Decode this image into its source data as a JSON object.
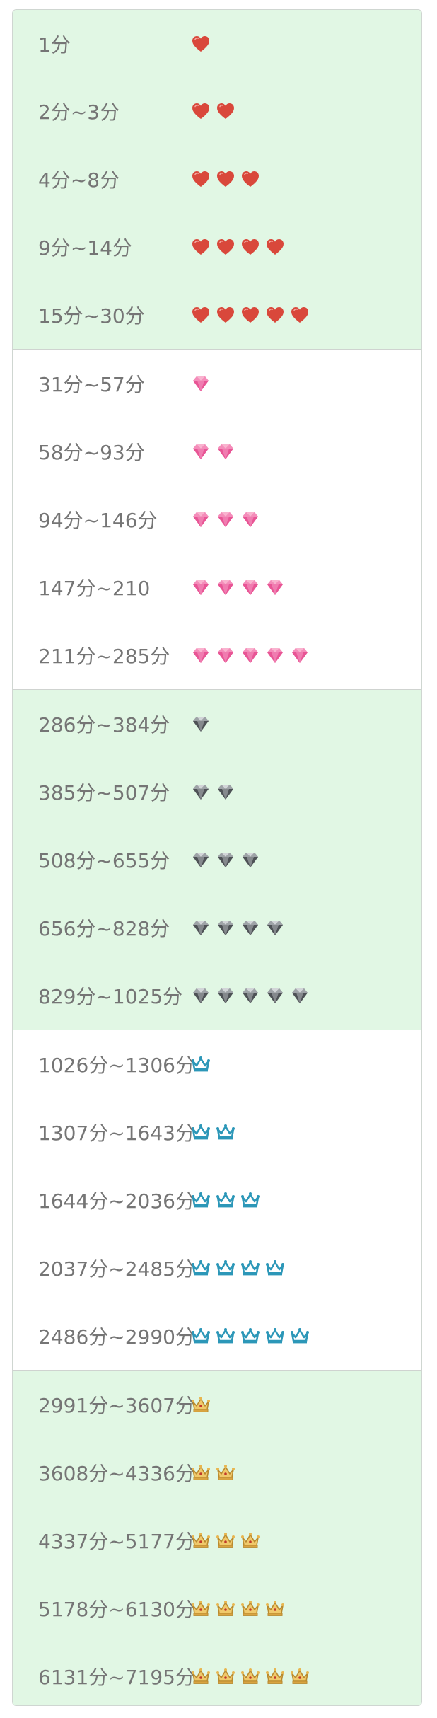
{
  "groups": [
    {
      "bg": "green",
      "icon": "heart-icon",
      "rows": [
        {
          "label": "1分",
          "count": 1
        },
        {
          "label": "2分~3分",
          "count": 2
        },
        {
          "label": "4分~8分",
          "count": 3
        },
        {
          "label": "9分~14分",
          "count": 4
        },
        {
          "label": "15分~30分",
          "count": 5
        }
      ]
    },
    {
      "bg": "white",
      "icon": "pink-diamond-icon",
      "rows": [
        {
          "label": "31分~57分",
          "count": 1
        },
        {
          "label": "58分~93分",
          "count": 2
        },
        {
          "label": "94分~146分",
          "count": 3
        },
        {
          "label": "147分~210",
          "count": 4
        },
        {
          "label": "211分~285分",
          "count": 5
        }
      ]
    },
    {
      "bg": "green",
      "icon": "silver-diamond-icon",
      "rows": [
        {
          "label": "286分~384分",
          "count": 1
        },
        {
          "label": "385分~507分",
          "count": 2
        },
        {
          "label": "508分~655分",
          "count": 3
        },
        {
          "label": "656分~828分",
          "count": 4
        },
        {
          "label": "829分~1025分",
          "count": 5
        }
      ]
    },
    {
      "bg": "white",
      "icon": "blue-crown-icon",
      "rows": [
        {
          "label": "1026分~1306分",
          "count": 1
        },
        {
          "label": "1307分~1643分",
          "count": 2
        },
        {
          "label": "1644分~2036分",
          "count": 3
        },
        {
          "label": "2037分~2485分",
          "count": 4
        },
        {
          "label": "2486分~2990分",
          "count": 5
        }
      ]
    },
    {
      "bg": "green",
      "icon": "gold-crown-icon",
      "rows": [
        {
          "label": "2991分~3607分",
          "count": 1
        },
        {
          "label": "3608分~4336分",
          "count": 2
        },
        {
          "label": "4337分~5177分",
          "count": 3
        },
        {
          "label": "5178分~6130分",
          "count": 4
        },
        {
          "label": "6131分~7195分",
          "count": 5
        }
      ]
    }
  ],
  "colors": {
    "green_bg": "#e1f7e4",
    "text": "#757575",
    "heart": "#d9483b",
    "pink_diamond": "#ef6ea6",
    "silver_diamond": "#6f7377",
    "blue_crown": "#2c97b8",
    "gold_crown": "#d9a441"
  }
}
